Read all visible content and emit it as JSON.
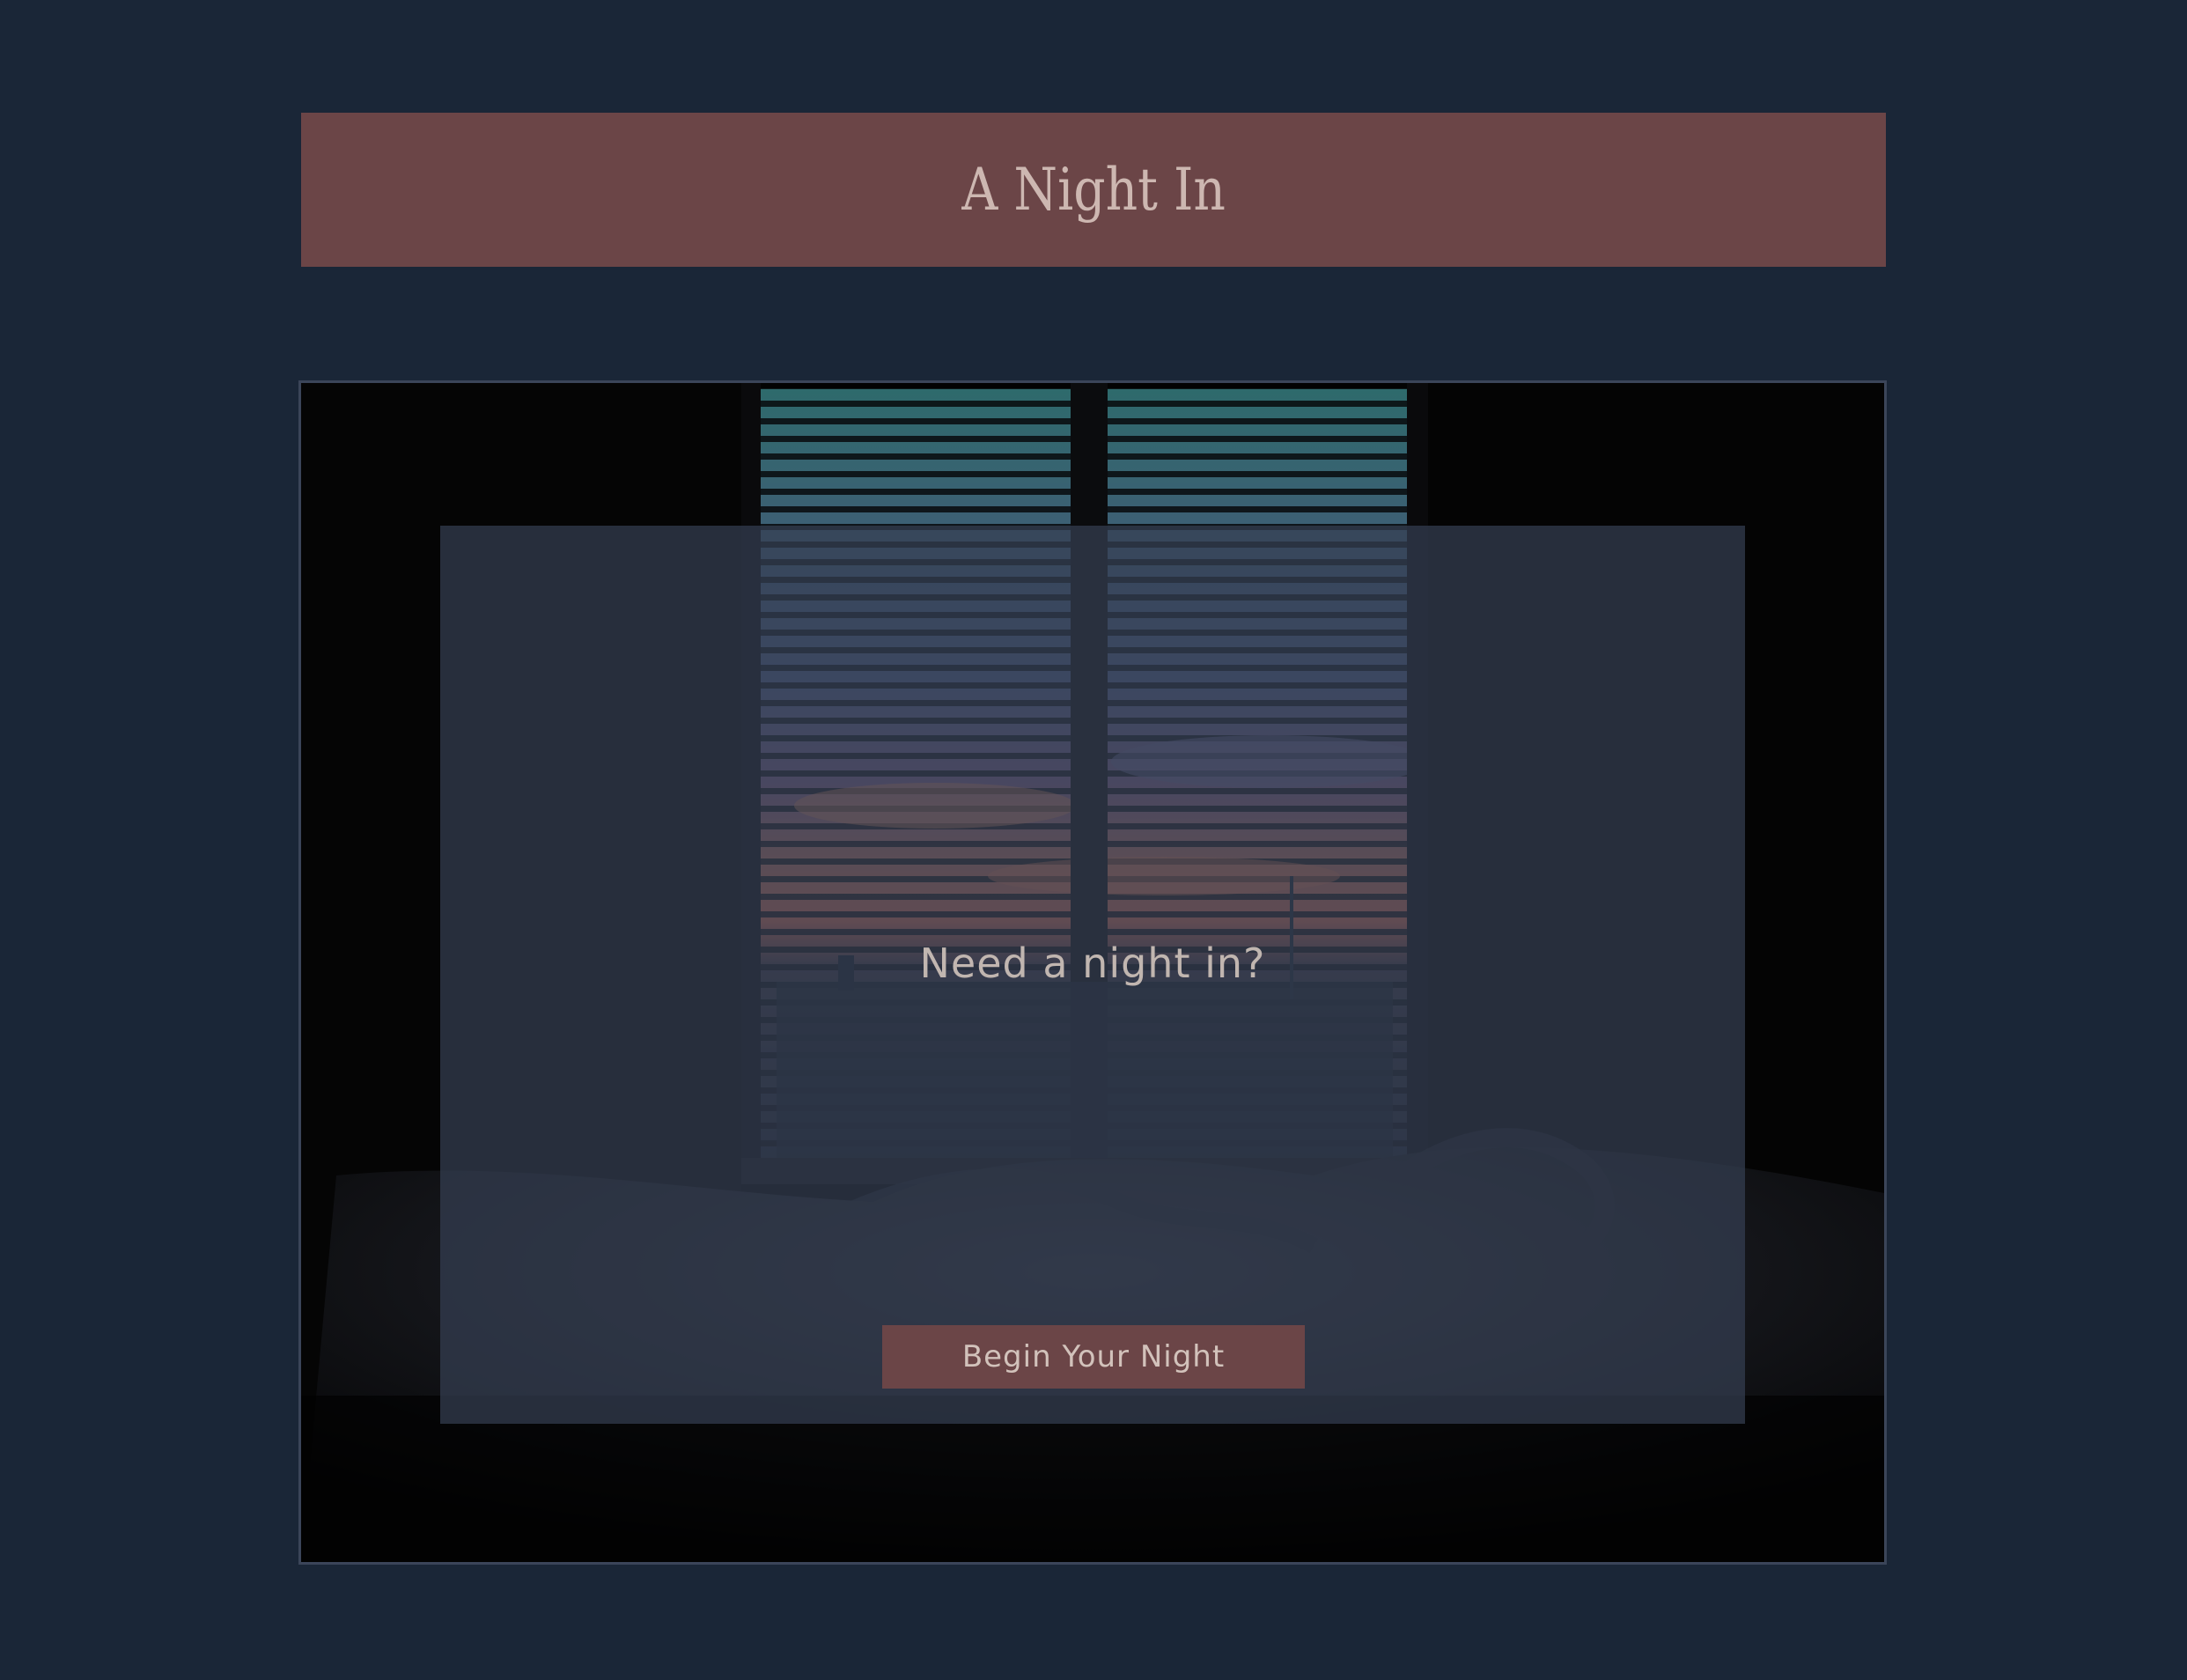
{
  "header": {
    "title": "A Night In"
  },
  "hero": {
    "image_alt": "Dark bedroom with a window and blinds at sunset, unmade bed in the foreground",
    "tagline": "Need a night in?",
    "cta_label": "Begin Your Night"
  },
  "colors": {
    "page_background": "#1a2637",
    "header_background": "#6b4547",
    "header_text": "#cdb7b1",
    "card_overlay": "#343e52",
    "button_background": "#6b4547",
    "button_text": "#d2c2bb"
  }
}
